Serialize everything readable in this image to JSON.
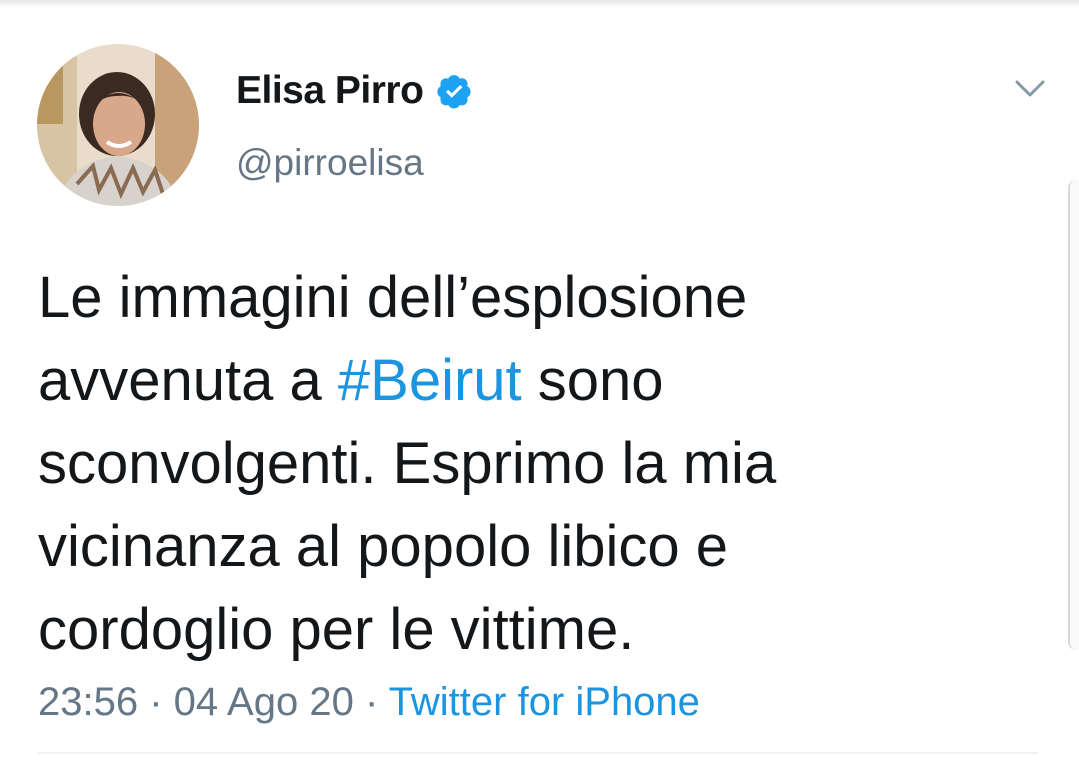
{
  "author": {
    "display_name": "Elisa Pirro",
    "handle": "@pirroelisa",
    "verified_icon": "verified-badge-icon",
    "avatar_icon": "avatar-photo"
  },
  "menu": {
    "icon": "chevron-down-icon"
  },
  "tweet": {
    "line1": "Le immagini dell’esplosione",
    "line2_pre": "avvenuta a ",
    "line2_hashtag": "#Beirut",
    "line2_post": " sono",
    "line3": "sconvolgenti. Esprimo la mia",
    "line4": "vicinanza al popolo libico e",
    "line5": "cordoglio per le vittime."
  },
  "meta": {
    "time": "23:56",
    "separator": " · ",
    "date": "04 Ago 20",
    "source": "Twitter for iPhone"
  },
  "colors": {
    "text": "#14171a",
    "secondary": "#657786",
    "link": "#1b95e0",
    "verified": "#1da1f2"
  }
}
